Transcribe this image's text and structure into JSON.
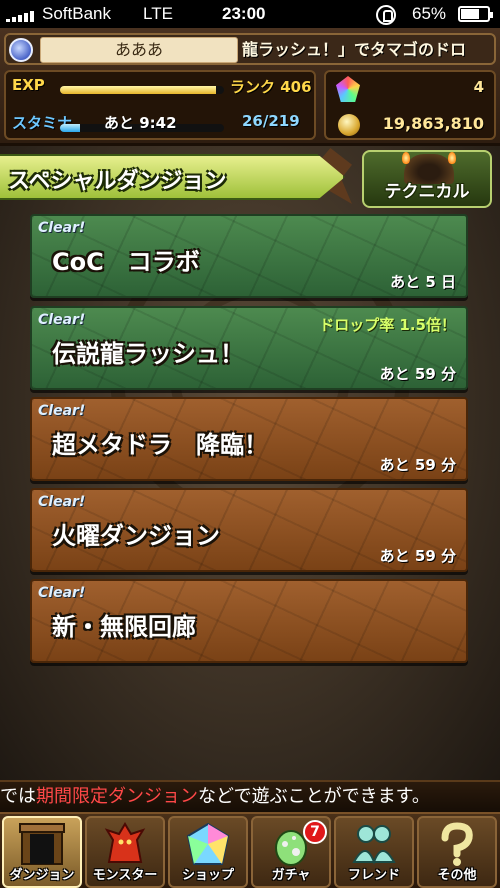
{
  "status_bar": {
    "carrier": "SoftBank",
    "network": "LTE",
    "time": "23:00",
    "battery": "65%"
  },
  "player": {
    "name": "あああ",
    "ticker": "龍ラッシュ！」でタマゴのドロ",
    "exp_label": "EXP",
    "rank": "ランク 406",
    "exp_progress": 0.95,
    "stamina_label": "スタミナ",
    "stamina_timer": "あと 9:42",
    "stamina_count": "26/219",
    "stamina_progress": 0.12,
    "magic_stones": "4",
    "coins": "19,863,810"
  },
  "section": {
    "title": "スペシャルダンジョン",
    "technical_label": "テクニカル"
  },
  "dungeons": [
    {
      "clear": "Clear!",
      "name": "CoC　コラボ",
      "remaining": "あと 5 日",
      "bonus": "",
      "color": "green"
    },
    {
      "clear": "Clear!",
      "name": "伝説龍ラッシュ！",
      "remaining": "あと 59 分",
      "bonus": "ドロップ率 1.5倍！",
      "color": "green"
    },
    {
      "clear": "Clear!",
      "name": "超メタドラ　降臨！",
      "remaining": "あと 59 分",
      "bonus": "",
      "color": "brown"
    },
    {
      "clear": "Clear!",
      "name": "火曜ダンジョン",
      "remaining": "あと 59 分",
      "bonus": "",
      "color": "brown"
    },
    {
      "clear": "Clear!",
      "name": "新・無限回廊",
      "remaining": "",
      "bonus": "",
      "color": "brown"
    }
  ],
  "info": {
    "prefix": "では",
    "highlight": "期間限定ダンジョン",
    "suffix": "などで遊ぶことができます。"
  },
  "nav": [
    {
      "label": "ダンジョン",
      "icon": "dungeon-gate-icon"
    },
    {
      "label": "モンスター",
      "icon": "dragon-icon"
    },
    {
      "label": "ショップ",
      "icon": "magic-stone-icon"
    },
    {
      "label": "ガチャ",
      "icon": "egg-icon",
      "badge": "7"
    },
    {
      "label": "フレンド",
      "icon": "friends-icon"
    },
    {
      "label": "その他",
      "icon": "question-icon"
    }
  ],
  "colors": {
    "green_panel": "#3f7a44",
    "brown_panel": "#8c5122",
    "highlight_red": "#ff4848",
    "gold_text": "#ffe79a"
  }
}
